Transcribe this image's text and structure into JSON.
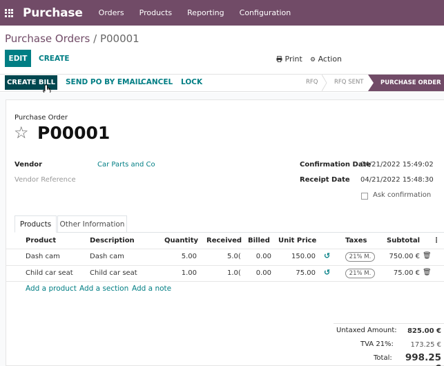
{
  "navbar": {
    "brand": "Purchase",
    "menu": [
      "Orders",
      "Products",
      "Reporting",
      "Configuration"
    ]
  },
  "breadcrumb": {
    "parent": "Purchase Orders",
    "separator": "/",
    "current": "P00001"
  },
  "controls": {
    "edit": "EDIT",
    "create": "CREATE",
    "print": "Print",
    "action": "Action"
  },
  "header_buttons": {
    "create_bill": "CREATE BILL",
    "send_po": "SEND PO BY EMAIL",
    "cancel": "CANCEL",
    "lock": "LOCK"
  },
  "statusbar": {
    "stages": [
      "RFQ",
      "RFQ SENT",
      "PURCHASE ORDER"
    ],
    "active": "PURCHASE ORDER"
  },
  "form": {
    "type_label": "Purchase Order",
    "name": "P00001",
    "vendor_label": "Vendor",
    "vendor_value": "Car Parts and Co",
    "vendor_ref_label": "Vendor Reference",
    "confirmation_label": "Confirmation Date",
    "confirmation_value": "04/21/2022 15:49:02",
    "receipt_label": "Receipt Date",
    "receipt_value": "04/21/2022 15:48:30",
    "ask_confirmation": "Ask confirmation"
  },
  "tabs": [
    "Products",
    "Other Information"
  ],
  "table": {
    "columns": [
      "Product",
      "Description",
      "Quantity",
      "Received",
      "Billed",
      "Unit Price",
      "Taxes",
      "Subtotal"
    ],
    "rows": [
      {
        "product": "Dash cam",
        "description": "Dash cam",
        "quantity": "5.00",
        "received": "5.0(",
        "billed": "0.00",
        "unit_price": "150.00",
        "tax": "21% M.",
        "subtotal": "750.00 €"
      },
      {
        "product": "Child car seat",
        "description": "Child car seat",
        "quantity": "1.00",
        "received": "1.0(",
        "billed": "0.00",
        "unit_price": "75.00",
        "tax": "21% M.",
        "subtotal": "75.00 €"
      }
    ],
    "add_links": [
      "Add a product",
      "Add a section",
      "Add a note"
    ]
  },
  "totals": {
    "untaxed_label": "Untaxed Amount:",
    "untaxed_value": "825.00 €",
    "tva_label": "TVA 21%:",
    "tva_value": "173.25 €",
    "total_label": "Total:",
    "total_value": "998.25 €"
  },
  "colors": {
    "brand": "#714b67",
    "primary": "#017e84",
    "dark_button": "#00474f"
  }
}
